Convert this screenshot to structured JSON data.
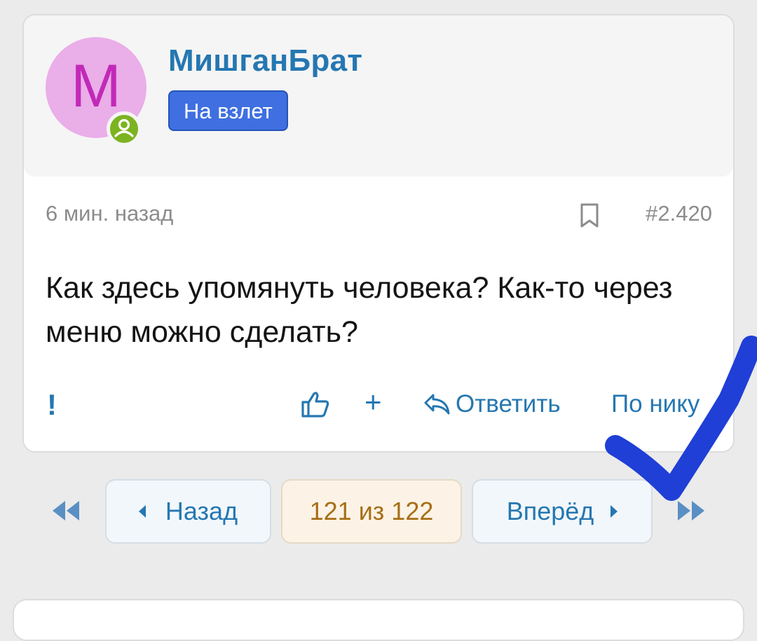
{
  "post": {
    "avatar_letter": "M",
    "username": "МишганБрат",
    "rank": "На взлет",
    "time": "6 мин. назад",
    "number": "#2.420",
    "message": "Как здесь упомянуть человека? Как-то через меню можно сделать?",
    "actions": {
      "report_label": "!",
      "plus_label": "+",
      "reply_label": "Ответить",
      "by_nick_label": "По нику"
    },
    "icons": {
      "online": "user-online-icon",
      "bookmark": "bookmark-icon",
      "like": "thumbs-up-icon",
      "reply": "reply-arrow-icon"
    }
  },
  "pagination": {
    "prev_label": "Назад",
    "current_label": "121 из 122",
    "next_label": "Вперёд",
    "first_icon": "double-chevron-left-icon",
    "last_icon": "double-chevron-right-icon"
  },
  "colors": {
    "accent": "#2577b1",
    "rank_bg": "#3f6fe0",
    "avatar_bg": "#eaaee8",
    "avatar_letter": "#c229b8",
    "online": "#7cb320",
    "current_page_text": "#a66f16",
    "annotation_mark": "#1f3fd6"
  }
}
